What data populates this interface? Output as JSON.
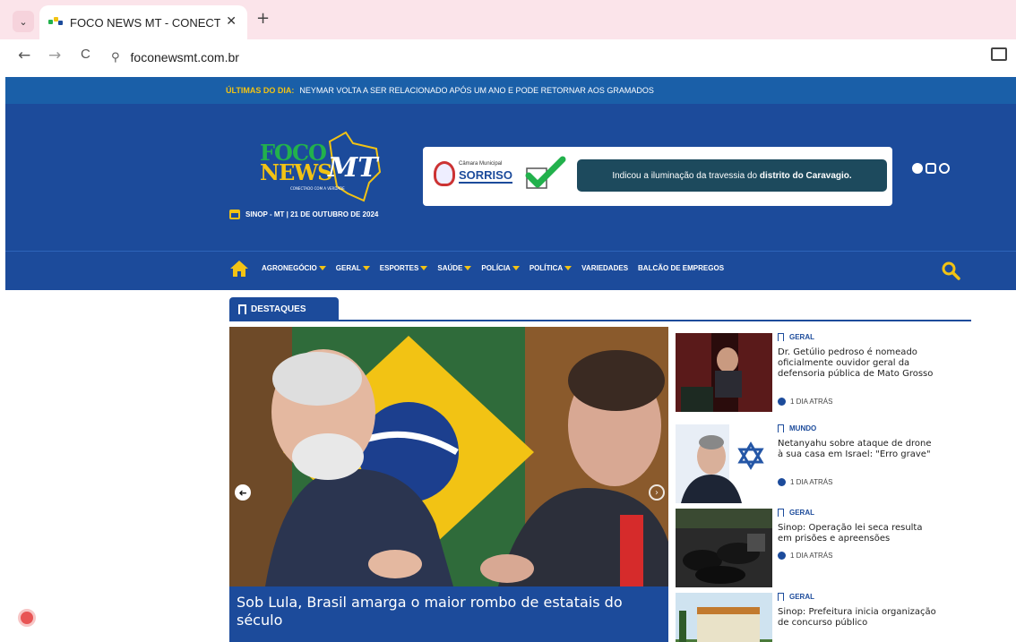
{
  "browser": {
    "tab_title": "FOCO NEWS MT - CONECTADO",
    "close_glyph": "✕",
    "new_tab_glyph": "+",
    "url": "foconewsmt.com.br",
    "back_glyph": "←",
    "forward_glyph": "→",
    "reload_glyph": "C",
    "tab_menu_glyph": "⌄",
    "site_info_glyph": "⚲"
  },
  "ticker": {
    "label": "ÚLTIMAS DO DIA:",
    "headline": "NEYMAR VOLTA A SER RELACIONADO APÓS UM ANO E PODE RETORNAR AOS GRAMADOS"
  },
  "header": {
    "logo": {
      "foco": "FOCO",
      "news": "NEWS",
      "mt": "MT",
      "tagline": "CONECTADO COM A VERDADE"
    },
    "date": "SINOP - MT | 21 DE OUTUBRO DE 2024",
    "ad": {
      "camara": "Câmara Municipal",
      "sorriso": "SORRISO",
      "text_plain": "Indicou a iluminação da travessia do ",
      "text_bold": "distrito do Caravagio."
    },
    "social_icons": [
      "facebook-icon",
      "instagram-icon",
      "whatsapp-icon"
    ]
  },
  "nav": {
    "items": [
      {
        "label": "AGRONEGÓCIO",
        "dropdown": true
      },
      {
        "label": "GERAL",
        "dropdown": true
      },
      {
        "label": "ESPORTES",
        "dropdown": true
      },
      {
        "label": "SAÚDE",
        "dropdown": true
      },
      {
        "label": "POLÍCIA",
        "dropdown": true
      },
      {
        "label": "POLÍTICA",
        "dropdown": true
      },
      {
        "label": "VARIEDADES",
        "dropdown": false
      },
      {
        "label": "BALCÃO DE EMPREGOS",
        "dropdown": false
      }
    ]
  },
  "featured": {
    "section_label": "DESTAQUES",
    "hero": {
      "title": "Sob Lula, Brasil amarga o maior rombo de estatais do século",
      "prev_glyph": "➜",
      "next_glyph": "›"
    },
    "side": [
      {
        "category": "GERAL",
        "title": "Dr. Getúlio pedroso é nomeado oficialmente ouvidor geral da defensoria pública de Mato Grosso",
        "time": "1 DIA ATRÁS"
      },
      {
        "category": "MUNDO",
        "title": "Netanyahu sobre ataque de drone à sua casa em Israel: \"Erro grave\"",
        "time": "1 DIA ATRÁS"
      },
      {
        "category": "GERAL",
        "title": "Sinop: Operação lei seca resulta em prisões e apreensões",
        "time": "1 DIA ATRÁS"
      },
      {
        "category": "GERAL",
        "title": "Sinop: Prefeitura inicia organização de concurso público",
        "time": ""
      }
    ]
  },
  "colors": {
    "brand_blue": "#1c4b9b",
    "ticker_blue": "#1a5fa8",
    "accent_yellow": "#f2c314",
    "logo_green": "#22b14c",
    "tab_bar_pink": "#fbe4ea"
  }
}
